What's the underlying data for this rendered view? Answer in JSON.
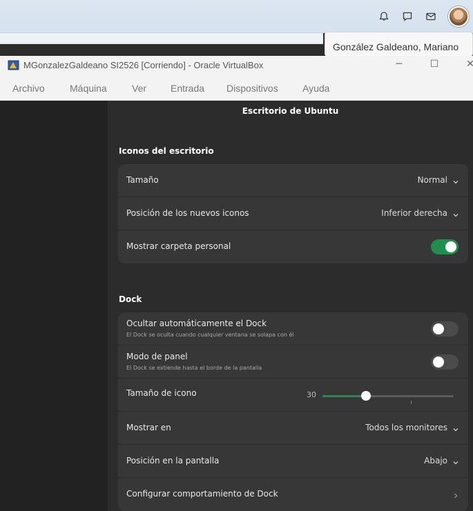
{
  "host": {
    "tooltip_name": "González Galdeano, Mariano",
    "icons": [
      "bell-icon",
      "chat-icon",
      "mail-icon",
      "user-avatar"
    ]
  },
  "vbox": {
    "title": "MGonzalezGaldeano SI2526 [Corriendo] - Oracle VirtualBox",
    "controls": {
      "minimize": "─",
      "maximize": "☐",
      "close": "✕"
    },
    "menu": [
      "Archivo",
      "Máquina",
      "Ver",
      "Entrada",
      "Dispositivos",
      "Ayuda"
    ]
  },
  "settings": {
    "panel_title": "Escritorio de Ubuntu",
    "desktop_icons": {
      "title": "Iconos del escritorio",
      "size_label": "Tamaño",
      "size_value": "Normal",
      "position_label": "Posición de los nuevos iconos",
      "position_value": "Inferior derecha",
      "home_label": "Mostrar carpeta personal",
      "home_on": true
    },
    "dock": {
      "title": "Dock",
      "autohide_label": "Ocultar automáticamente el Dock",
      "autohide_sub": "El Dock se oculta cuando cualquier ventana se solapa con él",
      "autohide_on": false,
      "panel_label": "Modo de panel",
      "panel_sub": "El Dock se extiende hasta el borde de la pantalla",
      "panel_on": false,
      "icon_size_label": "Tamaño de icono",
      "icon_size_value": "30",
      "icon_size_fraction": 0.33,
      "show_on_label": "Mostrar en",
      "show_on_value": "Todos los monitores",
      "screen_position_label": "Posición en la pantalla",
      "screen_position_value": "Abajo",
      "configure_label": "Configurar comportamiento de Dock"
    }
  },
  "colors": {
    "accent": "#1f8f4e",
    "background": "#2c2c2c",
    "card": "#373737",
    "sidebar": "#222222"
  }
}
